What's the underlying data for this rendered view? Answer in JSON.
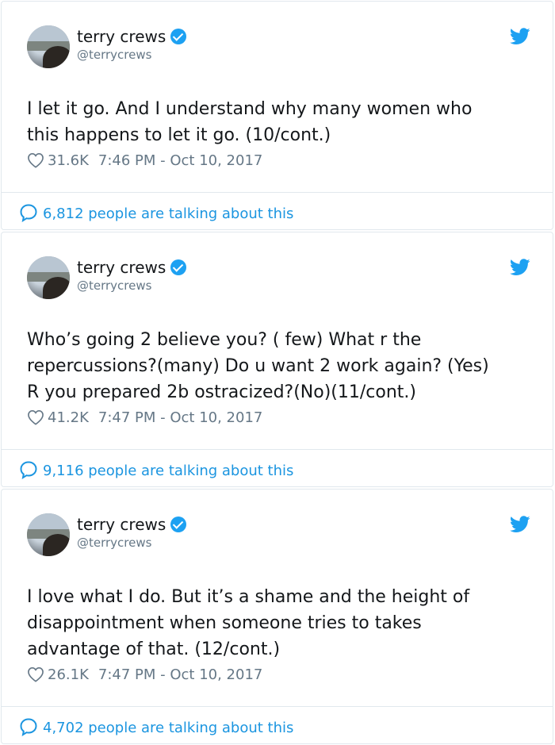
{
  "colors": {
    "link": "#1b95e0",
    "verified": "#1da1f2",
    "muted": "#657786",
    "text": "#14171a"
  },
  "tweets": [
    {
      "name": "terry crews",
      "handle": "@terrycrews",
      "text_lines": [
        "I let it go. And I understand why many women who",
        "this happens to let it go. (10/cont.)"
      ],
      "likes": "31.6K",
      "timestamp": "7:46 PM - Oct 10, 2017",
      "talking": "6,812 people are talking about this"
    },
    {
      "name": "terry crews",
      "handle": "@terrycrews",
      "text_lines": [
        "Who’s going 2 believe you? ( few) What r the",
        "repercussions?(many) Do u want 2 work again? (Yes)",
        "R you prepared 2b ostracized?(No)(11/cont.)"
      ],
      "likes": "41.2K",
      "timestamp": "7:47 PM - Oct 10, 2017",
      "talking": "9,116 people are talking about this"
    },
    {
      "name": "terry crews",
      "handle": "@terrycrews",
      "text_lines": [
        "I love what I do. But it’s a shame and the height of",
        "disappointment when someone tries to takes",
        "advantage of that. (12/cont.)"
      ],
      "likes": "26.1K",
      "timestamp": "7:47 PM - Oct 10, 2017",
      "talking": "4,702 people are talking about this"
    }
  ],
  "icons": {
    "verified": "verified-badge-icon",
    "twitter": "twitter-bird-icon",
    "like": "heart-icon",
    "reply": "speech-bubble-icon"
  }
}
